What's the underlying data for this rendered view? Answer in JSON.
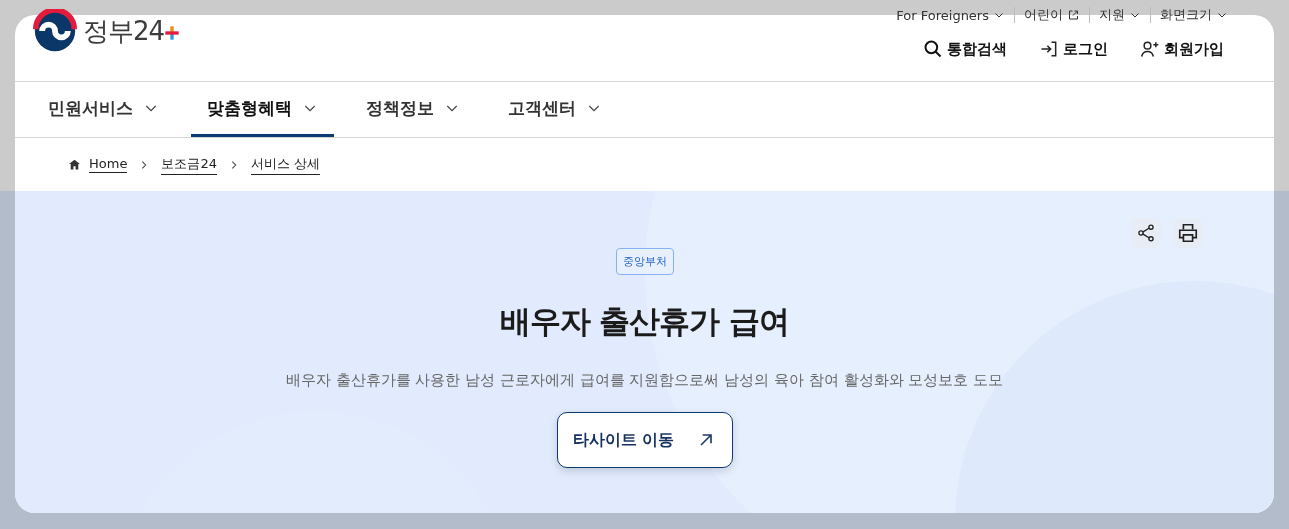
{
  "logo": {
    "text": "정부24"
  },
  "utility_links": [
    {
      "label": "For Foreigners",
      "kind": "menu"
    },
    {
      "label": "어린이",
      "kind": "external"
    },
    {
      "label": "지원",
      "kind": "menu"
    },
    {
      "label": "화면크기",
      "kind": "menu"
    }
  ],
  "header_actions": [
    {
      "label": "통합검색",
      "kind": "search"
    },
    {
      "label": "로그인",
      "kind": "login"
    },
    {
      "label": "회원가입",
      "kind": "signup"
    }
  ],
  "nav": [
    {
      "label": "민원서비스",
      "selected": false
    },
    {
      "label": "맞춤형혜택",
      "selected": true
    },
    {
      "label": "정책정보",
      "selected": false
    },
    {
      "label": "고객센터",
      "selected": false
    }
  ],
  "breadcrumb": [
    "Home",
    "보조금24",
    "서비스 상세"
  ],
  "hero": {
    "badge": "중앙부처",
    "title": "배우자 출산휴가 급여",
    "description": "배우자 출산휴가를 사용한 남성 근로자에게 급여를 지원함으로써 남성의 육아 참여 활성화와 모성보호 도모",
    "button": "타사이트 이동"
  }
}
